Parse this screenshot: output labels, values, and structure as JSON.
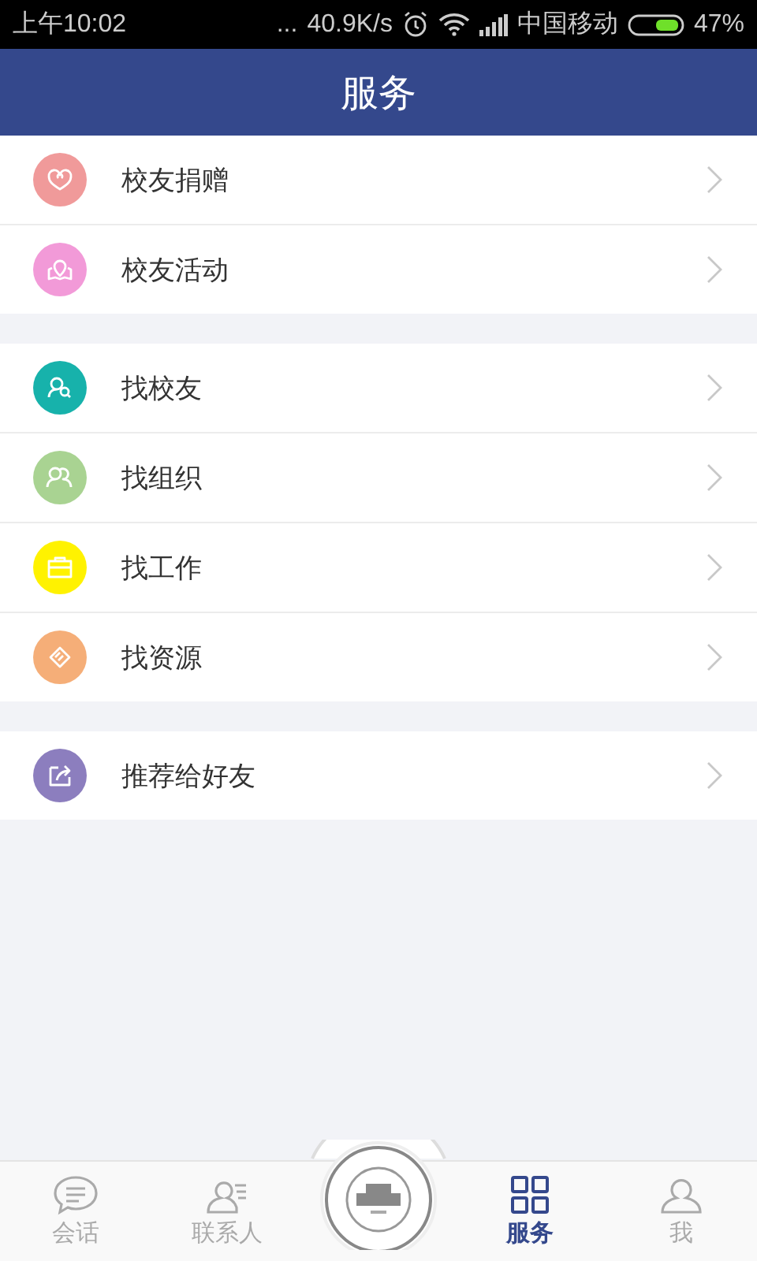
{
  "status_bar": {
    "time": "上午10:02",
    "dots": "...",
    "speed": "40.9K/s",
    "carrier": "中国移动",
    "battery": "47%"
  },
  "header": {
    "title": "服务"
  },
  "groups": [
    {
      "items": [
        {
          "label": "校友捐赠",
          "color": "#f09a9a"
        },
        {
          "label": "校友活动",
          "color": "#f29ad8"
        }
      ]
    },
    {
      "items": [
        {
          "label": "找校友",
          "color": "#17b2ab"
        },
        {
          "label": "找组织",
          "color": "#a9d392"
        },
        {
          "label": "找工作",
          "color": "#fff200"
        },
        {
          "label": "找资源",
          "color": "#f5ae78"
        }
      ]
    },
    {
      "items": [
        {
          "label": "推荐给好友",
          "color": "#8c7ebe"
        }
      ]
    }
  ],
  "tabs": [
    {
      "label": "会话",
      "selected": false
    },
    {
      "label": "联系人",
      "selected": false
    },
    {
      "label": "服务",
      "selected": true
    },
    {
      "label": "我",
      "selected": false
    }
  ]
}
